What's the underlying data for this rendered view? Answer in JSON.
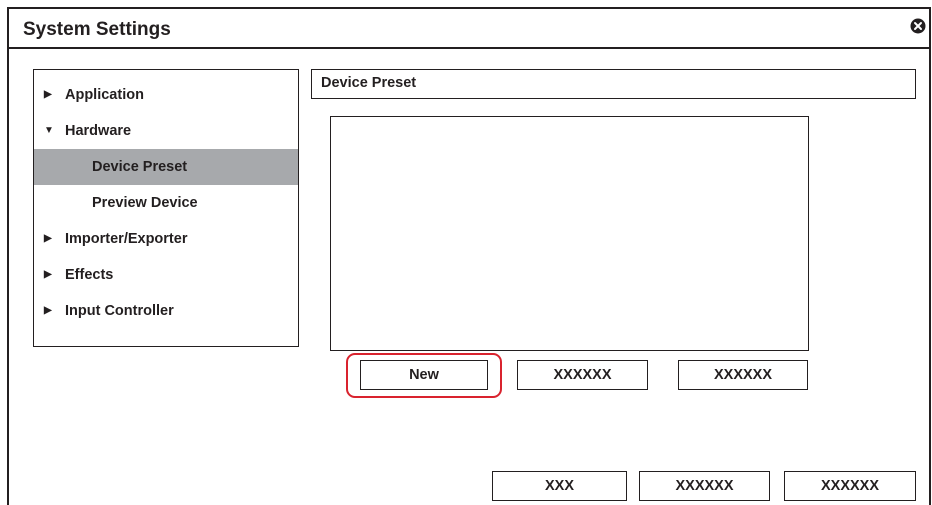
{
  "window": {
    "title": "System Settings",
    "close_icon": "close-circle-x-icon"
  },
  "tree": {
    "items": [
      {
        "label": "Application",
        "expander": "collapsed",
        "level": 0,
        "selected": false
      },
      {
        "label": "Hardware",
        "expander": "expanded",
        "level": 0,
        "selected": false
      },
      {
        "label": "Device Preset",
        "expander": "none",
        "level": 1,
        "selected": true
      },
      {
        "label": "Preview Device",
        "expander": "none",
        "level": 1,
        "selected": false
      },
      {
        "label": "Importer/Exporter",
        "expander": "collapsed",
        "level": 0,
        "selected": false
      },
      {
        "label": "Effects",
        "expander": "collapsed",
        "level": 0,
        "selected": false
      },
      {
        "label": "Input Controller",
        "expander": "collapsed",
        "level": 0,
        "selected": false
      }
    ]
  },
  "panel": {
    "header": "Device Preset",
    "preset_buttons": {
      "new_label": "New",
      "button2_label": "XXXXXX",
      "button3_label": "XXXXXX"
    }
  },
  "footer": {
    "button1_label": "XXX",
    "button2_label": "XXXXXX",
    "button3_label": "XXXXXX"
  },
  "colors": {
    "text": "#231f20",
    "selected_row": "#a7a9ac",
    "highlight": "#d9232e"
  }
}
